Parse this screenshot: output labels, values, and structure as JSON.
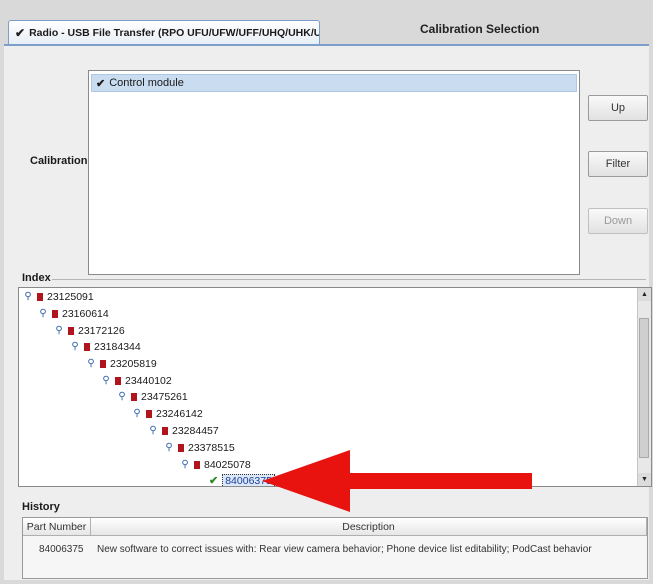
{
  "tab": {
    "label": "Radio - USB File Transfer (RPO UFU/UFW/UFF/UHQ/UHK/UHR/UHJ)"
  },
  "header": {
    "title": "Calibration Selection"
  },
  "calibration": {
    "label": "Calibration",
    "items": [
      {
        "label": "Control module",
        "checked": true
      }
    ]
  },
  "buttons": {
    "up": "Up",
    "filter": "Filter",
    "down": "Down"
  },
  "index": {
    "label": "Index",
    "nodes": [
      "23125091",
      "23160614",
      "23172126",
      "23184344",
      "23205819",
      "23440102",
      "23475261",
      "23246142",
      "23284457",
      "23378515",
      "84025078",
      "84006375"
    ],
    "selected": "84006375"
  },
  "history": {
    "label": "History",
    "columns": [
      "Part Number",
      "Description"
    ],
    "rows": [
      {
        "part_number": "84006375",
        "description": "New software to correct issues with: Rear view camera behavior; Phone device list editability; PodCast behavior"
      }
    ]
  },
  "colors": {
    "accent": "#7d9ec8",
    "arrow": "#e8120f",
    "selection": "#c9dcf0"
  }
}
